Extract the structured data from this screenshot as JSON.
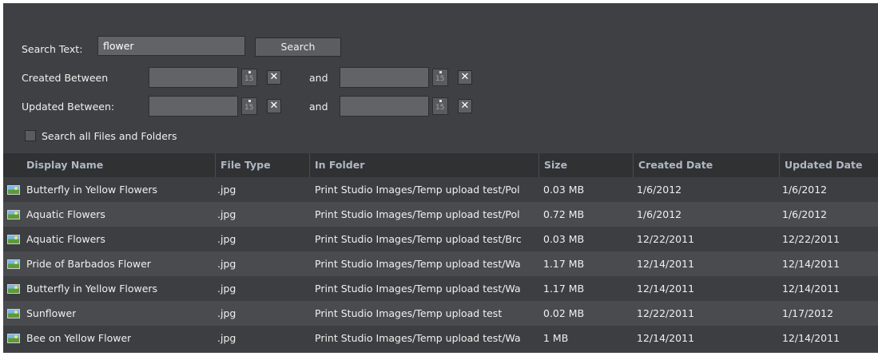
{
  "search": {
    "label": "Search Text:",
    "value": "flower",
    "button": "Search"
  },
  "created": {
    "label": "Created Between",
    "and": "and",
    "cal_num": "15",
    "clear": "✕"
  },
  "updated": {
    "label": "Updated Between:",
    "and": "and",
    "cal_num": "15",
    "clear": "✕"
  },
  "search_all": {
    "label": "Search all Files and Folders",
    "checked": false
  },
  "columns": [
    "Display Name",
    "File Type",
    "In Folder",
    "Size",
    "Created Date",
    "Updated Date"
  ],
  "rows": [
    [
      "Butterfly in Yellow Flowers",
      ".jpg",
      "Print Studio Images/Temp upload test/Pol",
      "0.03 MB",
      "1/6/2012",
      "1/6/2012"
    ],
    [
      "Aquatic Flowers",
      ".jpg",
      "Print Studio Images/Temp upload test/Pol",
      "0.72 MB",
      "1/6/2012",
      "1/6/2012"
    ],
    [
      "Aquatic Flowers",
      ".jpg",
      "Print Studio Images/Temp upload test/Brc",
      "0.03 MB",
      "12/22/2011",
      "12/22/2011"
    ],
    [
      "Pride of Barbados Flower",
      ".jpg",
      "Print Studio Images/Temp upload test/Wa",
      "1.17 MB",
      "12/14/2011",
      "12/14/2011"
    ],
    [
      "Butterfly in Yellow Flowers",
      ".jpg",
      "Print Studio Images/Temp upload test/Wa",
      "1.17 MB",
      "12/14/2011",
      "12/14/2011"
    ],
    [
      "Sunflower",
      ".jpg",
      "Print Studio Images/Temp upload test",
      "0.02 MB",
      "12/22/2011",
      "1/17/2012"
    ],
    [
      "Bee on Yellow Flower",
      ".jpg",
      "Print Studio Images/Temp upload test/Wa",
      "1 MB",
      "12/14/2011",
      "12/14/2011"
    ]
  ],
  "row_icon": "image-file-icon"
}
